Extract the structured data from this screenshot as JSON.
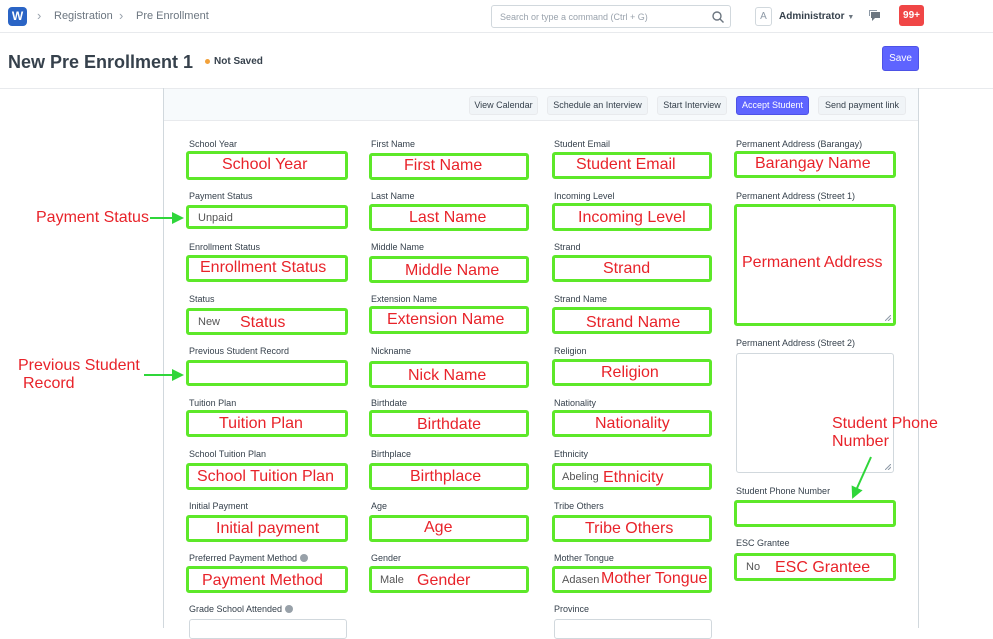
{
  "app": {
    "logo": "W"
  },
  "breadcrumbs": [
    "Registration",
    "Pre Enrollment"
  ],
  "search": {
    "placeholder": "Search or type a command (Ctrl + G)"
  },
  "user": {
    "initial": "A",
    "name": "Administrator"
  },
  "notifications": {
    "count": "99+"
  },
  "page": {
    "title": "New Pre Enrollment 1",
    "status": "Not Saved",
    "save_label": "Save"
  },
  "toolbar": {
    "view_calendar": "View Calendar",
    "schedule_interview": "Schedule an Interview",
    "start_interview": "Start Interview",
    "accept_student": "Accept Student",
    "send_payment_link": "Send payment link"
  },
  "fields": {
    "school_year": {
      "label": "School Year",
      "annotation": "School Year"
    },
    "payment_status": {
      "label": "Payment Status",
      "value": "Unpaid"
    },
    "enrollment_status": {
      "label": "Enrollment Status",
      "annotation": "Enrollment Status"
    },
    "status": {
      "label": "Status",
      "value": "New",
      "annotation": "Status"
    },
    "previous_student_record": {
      "label": "Previous Student Record"
    },
    "tuition_plan": {
      "label": "Tuition Plan",
      "annotation": "Tuition Plan"
    },
    "school_tuition_plan": {
      "label": "School Tuition Plan",
      "annotation": "School Tuition Plan"
    },
    "initial_payment": {
      "label": "Initial Payment",
      "annotation": "Initial payment"
    },
    "preferred_payment_method": {
      "label": "Preferred Payment Method",
      "annotation": "Payment Method"
    },
    "grade_school_attended": {
      "label": "Grade School Attended"
    },
    "first_name": {
      "label": "First Name",
      "annotation": "First Name"
    },
    "last_name": {
      "label": "Last Name",
      "annotation": "Last Name"
    },
    "middle_name": {
      "label": "Middle Name",
      "annotation": "Middle Name"
    },
    "extension_name": {
      "label": "Extension Name",
      "annotation": "Extension Name"
    },
    "nickname": {
      "label": "Nickname",
      "annotation": "Nick Name"
    },
    "birthdate": {
      "label": "Birthdate",
      "annotation": "Birthdate"
    },
    "birthplace": {
      "label": "Birthplace",
      "annotation": "Birthplace"
    },
    "age": {
      "label": "Age",
      "annotation": "Age"
    },
    "gender": {
      "label": "Gender",
      "value": "Male",
      "annotation": "Gender"
    },
    "student_email": {
      "label": "Student Email",
      "annotation": "Student Email"
    },
    "incoming_level": {
      "label": "Incoming Level",
      "annotation": "Incoming Level"
    },
    "strand": {
      "label": "Strand",
      "annotation": "Strand"
    },
    "strand_name": {
      "label": "Strand Name",
      "annotation": "Strand Name"
    },
    "religion": {
      "label": "Religion",
      "annotation": "Religion"
    },
    "nationality": {
      "label": "Nationality",
      "annotation": "Nationality"
    },
    "ethnicity": {
      "label": "Ethnicity",
      "value": "Abeling",
      "annotation": "Ethnicity"
    },
    "tribe_others": {
      "label": "Tribe Others",
      "annotation": "Tribe Others"
    },
    "mother_tongue": {
      "label": "Mother Tongue",
      "value": "Adasen",
      "annotation": "Mother Tongue"
    },
    "province": {
      "label": "Province"
    },
    "permanent_address_barangay": {
      "label": "Permanent Address (Barangay)",
      "annotation": "Barangay Name"
    },
    "permanent_address_street1": {
      "label": "Permanent Address (Street 1)",
      "annotation": "Permanent Address"
    },
    "permanent_address_street2": {
      "label": "Permanent Address (Street 2)"
    },
    "student_phone_number": {
      "label": "Student Phone Number"
    },
    "esc_grantee": {
      "label": "ESC Grantee",
      "value": "No",
      "annotation": "ESC Grantee"
    }
  },
  "side_annotations": {
    "payment_status": "Payment Status",
    "previous_student_record_line1": "Previous Student",
    "previous_student_record_line2": "Record",
    "student_phone_line1": "Student Phone",
    "student_phone_line2": "Number"
  },
  "colors": {
    "primary": "#5e64ff",
    "annotation_red": "#e8232a",
    "annotation_green": "#5de829",
    "notification": "#f04646",
    "unsaved_dot": "#f2a139"
  }
}
